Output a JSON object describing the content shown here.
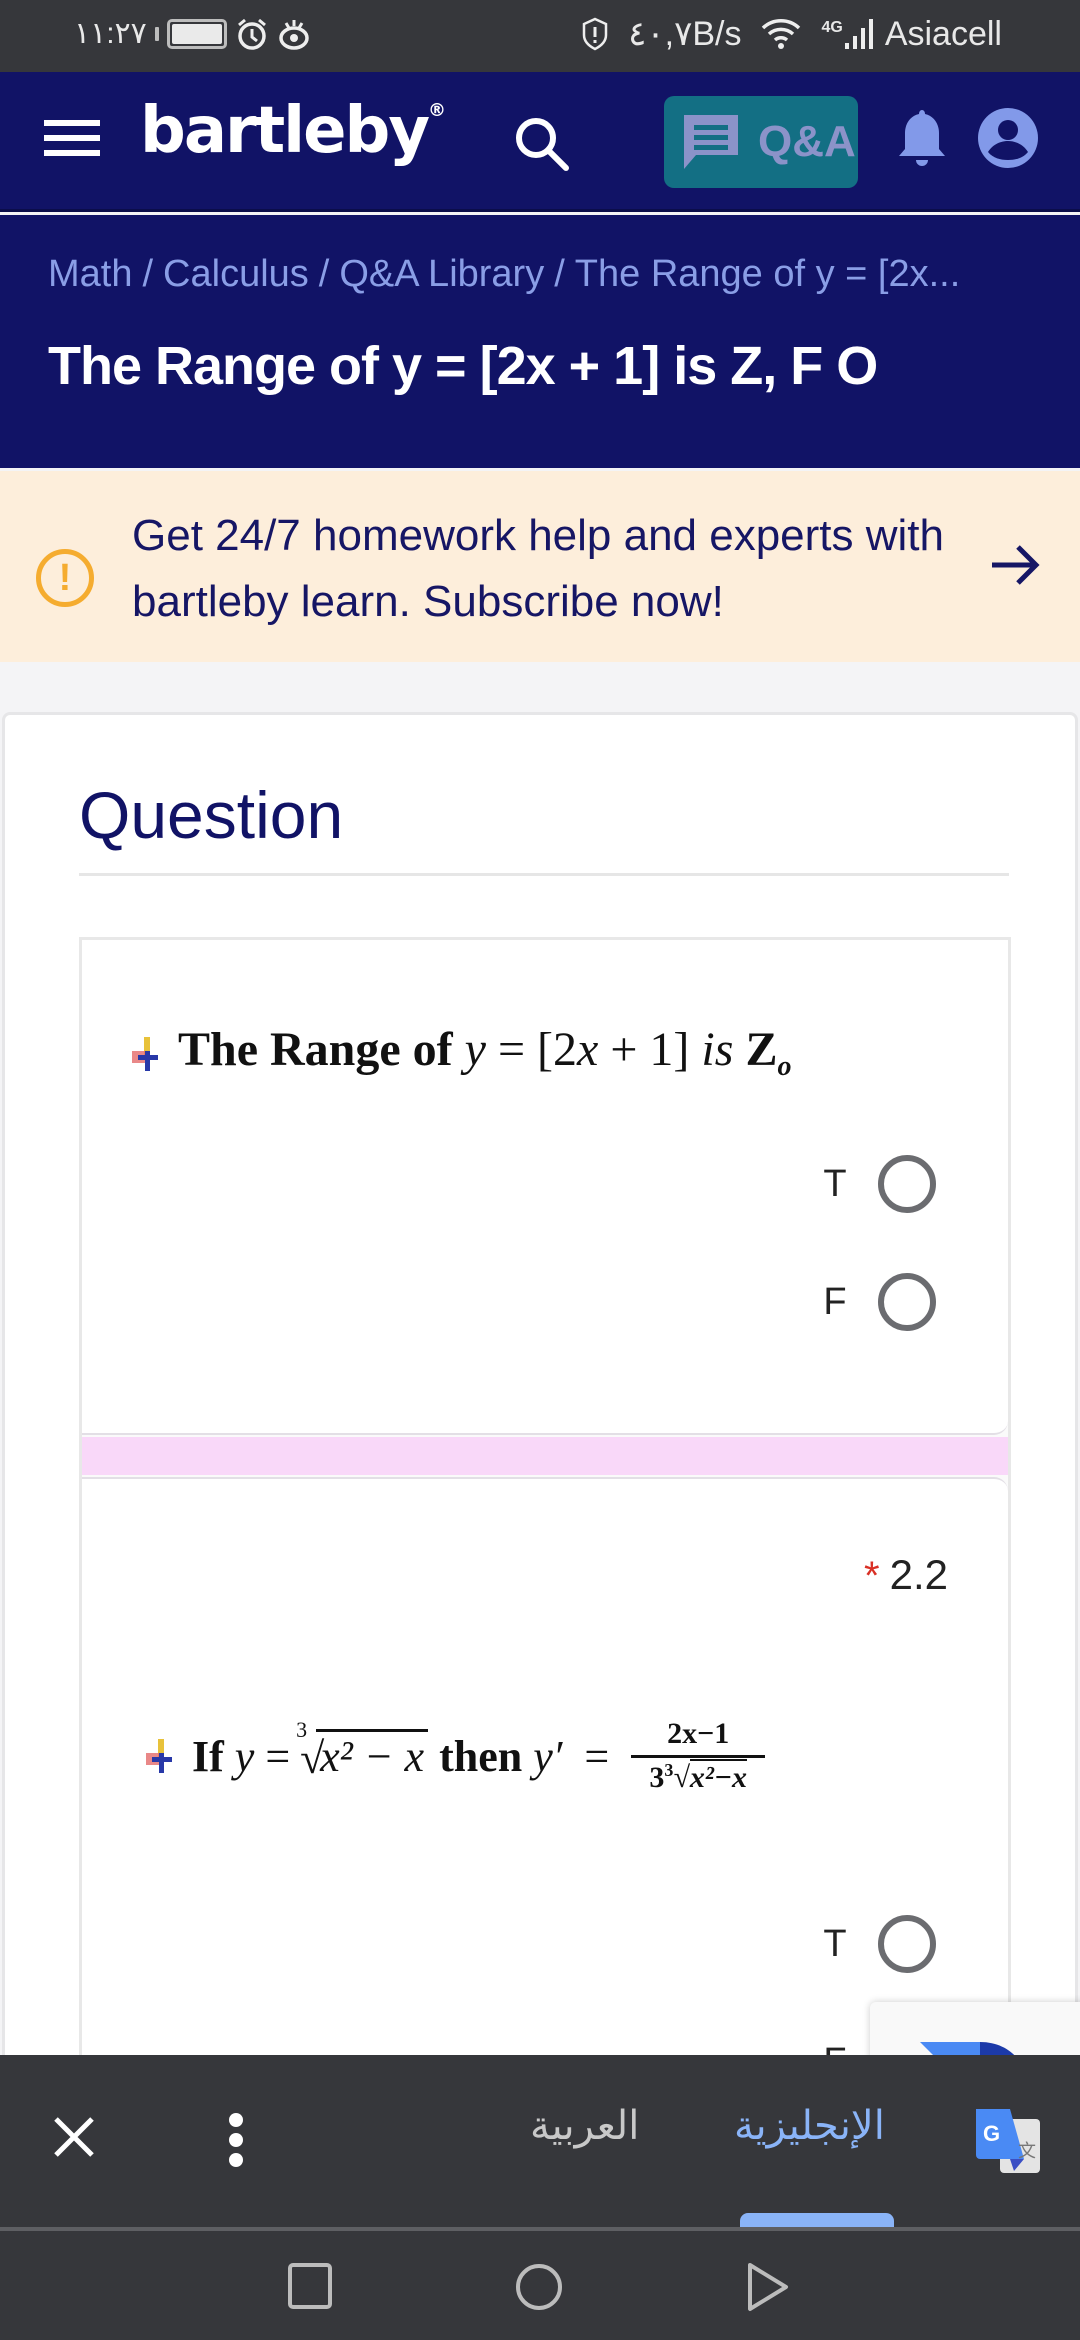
{
  "status_bar": {
    "time": "١١:٢٧",
    "network_speed": "٤٠,٧B/s",
    "network_type": "4G",
    "carrier": "Asiacell",
    "icons": [
      "battery-icon",
      "alarm-icon",
      "eye-comfort-icon",
      "shield-alert-icon",
      "wifi-icon",
      "signal-icon"
    ]
  },
  "header": {
    "logo": "bartleby",
    "logo_mark": "®",
    "qa_button_label": "Q&A",
    "icons": [
      "menu-icon",
      "search-icon",
      "chat-icon",
      "bell-icon",
      "account-icon"
    ],
    "brand_color": "#111366",
    "qa_button_color": "#136f84"
  },
  "breadcrumb": {
    "items": [
      "Math",
      "Calculus",
      "Q&A Library",
      "The Range of y = [2x..."
    ],
    "separator": "/"
  },
  "page_title": "The Range of y = [2x + 1] is Z, F O",
  "promo": {
    "text": "Get 24/7 homework help and experts with bartleby learn. Subscribe now!",
    "icon": "alert-circle-icon",
    "arrow_icon": "arrow-right-icon",
    "background": "#fdeedb",
    "accent": "#f5ac2f"
  },
  "question": {
    "heading": "Question",
    "items": [
      {
        "text_prefix": "The Range of",
        "var": "y",
        "eq": "= [2",
        "var2": "x",
        "rest": "+ 1]",
        "is": "is",
        "set": "Z",
        "set_sub": "o",
        "options": [
          {
            "label": "T",
            "selected": false
          },
          {
            "label": "F",
            "selected": false
          }
        ]
      },
      {
        "number": "2.2",
        "required_mark": "*",
        "if": "If",
        "y": "y",
        "eq": "=",
        "root_index": "3",
        "radicand": "x² − x",
        "then": "then",
        "yprime": "y′",
        "eq2": "=",
        "frac_num": "2x−1",
        "frac_den_coef": "3",
        "frac_den_index": "3",
        "frac_den_radicand": "x²−x",
        "options": [
          {
            "label": "T",
            "selected": false
          },
          {
            "label": "F",
            "selected": false
          }
        ]
      }
    ]
  },
  "translate_bar": {
    "source_lang": "العربية",
    "target_lang": "الإنجليزية",
    "active": "target",
    "icons": [
      "close-icon",
      "more-vert-icon",
      "google-translate-icon"
    ]
  },
  "nav_bar": {
    "buttons": [
      "recents",
      "home",
      "back"
    ]
  }
}
